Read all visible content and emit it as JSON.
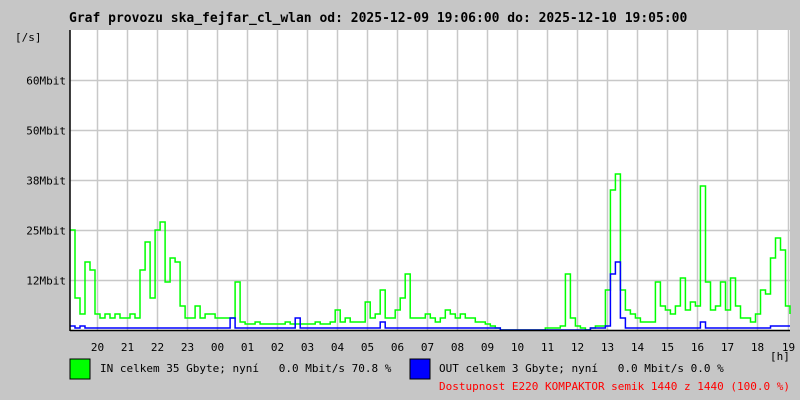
{
  "chart_data": {
    "type": "line",
    "title": "Graf provozu ska_fejfar_cl_wlan od: 2025-12-09 19:06:00 do: 2025-12-10 19:05:00",
    "ylabel": "[/s]",
    "xlabel": "[h]",
    "ylim_mbit": [
      0,
      75
    ],
    "y_ticks": [
      {
        "value": 12.5,
        "label": "12Mbit"
      },
      {
        "value": 25,
        "label": "25Mbit"
      },
      {
        "value": 37.5,
        "label": "38Mbit"
      },
      {
        "value": 50,
        "label": "50Mbit"
      },
      {
        "value": 62.5,
        "label": "60Mbit"
      }
    ],
    "x_range_hours": [
      19.1,
      43.083
    ],
    "x_ticks": [
      "20",
      "21",
      "22",
      "23",
      "00",
      "01",
      "02",
      "03",
      "04",
      "05",
      "06",
      "07",
      "08",
      "09",
      "10",
      "11",
      "12",
      "13",
      "14",
      "15",
      "16",
      "17",
      "18",
      "19"
    ],
    "x_tick_hours": [
      20,
      21,
      22,
      23,
      24,
      25,
      26,
      27,
      28,
      29,
      30,
      31,
      32,
      33,
      34,
      35,
      36,
      37,
      38,
      39,
      40,
      41,
      42,
      43
    ],
    "sample_interval_min": 10,
    "grid": true,
    "series": [
      {
        "name": "IN",
        "color": "#00ff00",
        "values": [
          25,
          8,
          4,
          17,
          15,
          4,
          3,
          4,
          3,
          4,
          3,
          3,
          4,
          3,
          15,
          22,
          8,
          25,
          27,
          12,
          18,
          17,
          6,
          3,
          3,
          6,
          3,
          4,
          4,
          3,
          3,
          3,
          3,
          12,
          2,
          1.5,
          1.5,
          2,
          1.5,
          1.5,
          1.5,
          1.5,
          1.5,
          2,
          1.5,
          1.5,
          1.5,
          1.5,
          1.5,
          2,
          1.5,
          1.5,
          2,
          5,
          2,
          3,
          2,
          2,
          2,
          7,
          3,
          4,
          10,
          3,
          3,
          5,
          8,
          14,
          3,
          3,
          3,
          4,
          3,
          2,
          3,
          5,
          4,
          3,
          4,
          3,
          3,
          2,
          2,
          1.5,
          1,
          0.5,
          0,
          0,
          0,
          0,
          0,
          0,
          0,
          0,
          0,
          0.5,
          0.5,
          0.5,
          1,
          14,
          3,
          1,
          0.5,
          0,
          0.5,
          1,
          1,
          10,
          35,
          39,
          10,
          5,
          4,
          3,
          2,
          2,
          2,
          12,
          6,
          5,
          4,
          6,
          13,
          5,
          7,
          6,
          36,
          12,
          5,
          6,
          12,
          5,
          13,
          6,
          3,
          3,
          2,
          4,
          10,
          9,
          18,
          23,
          20,
          6,
          4
        ]
      },
      {
        "name": "OUT",
        "color": "#0000ff",
        "values": [
          1,
          0.5,
          1,
          0.5,
          0.5,
          0.5,
          0.5,
          0.5,
          0.5,
          0.5,
          0.5,
          0.5,
          0.5,
          0.5,
          0.5,
          0.5,
          0.5,
          0.5,
          0.5,
          0.5,
          0.5,
          0.5,
          0.5,
          0.5,
          0.5,
          0.5,
          0.5,
          0.5,
          0.5,
          0.5,
          0.5,
          0.5,
          3,
          0.5,
          0.5,
          0.5,
          0.5,
          0.5,
          0.5,
          0.5,
          0.5,
          0.5,
          0.5,
          0.5,
          0.5,
          3,
          0.5,
          0.5,
          0.5,
          0.5,
          0.5,
          0.5,
          0.5,
          0.5,
          0.5,
          0.5,
          0.5,
          0.5,
          0.5,
          0.5,
          0.5,
          0.5,
          2,
          0.5,
          0.5,
          0.5,
          0.5,
          0.5,
          0.5,
          0.5,
          0.5,
          0.5,
          0.5,
          0.5,
          0.5,
          0.5,
          0.5,
          0.5,
          0.5,
          0.5,
          0.5,
          0.5,
          0.5,
          0.5,
          0.5,
          0.5,
          0,
          0,
          0,
          0,
          0,
          0,
          0,
          0,
          0,
          0,
          0,
          0,
          0,
          0,
          0,
          0,
          0,
          0,
          0.5,
          0.5,
          0.5,
          1,
          14,
          17,
          3,
          0.5,
          0.5,
          0.5,
          0.5,
          0.5,
          0.5,
          0.5,
          0.5,
          0.5,
          0.5,
          0.5,
          0.5,
          0.5,
          0.5,
          0.5,
          2,
          0.5,
          0.5,
          0.5,
          0.5,
          0.5,
          0.5,
          0.5,
          0.5,
          0.5,
          0.5,
          0.5,
          0.5,
          0.5,
          1,
          1,
          1,
          1,
          1
        ]
      }
    ]
  },
  "legend": {
    "in_text": "IN celkem 35 Gbyte; nyní   0.0 Mbit/s 70.8 %",
    "out_text": "OUT celkem 3 Gbyte; nyní   0.0 Mbit/s 0.0 %",
    "in_color": "#00ff00",
    "out_color": "#0000ff",
    "availability": "Dostupnost E220 KOMPAKTOR semik 1440 z 1440 (100.0 %)"
  }
}
